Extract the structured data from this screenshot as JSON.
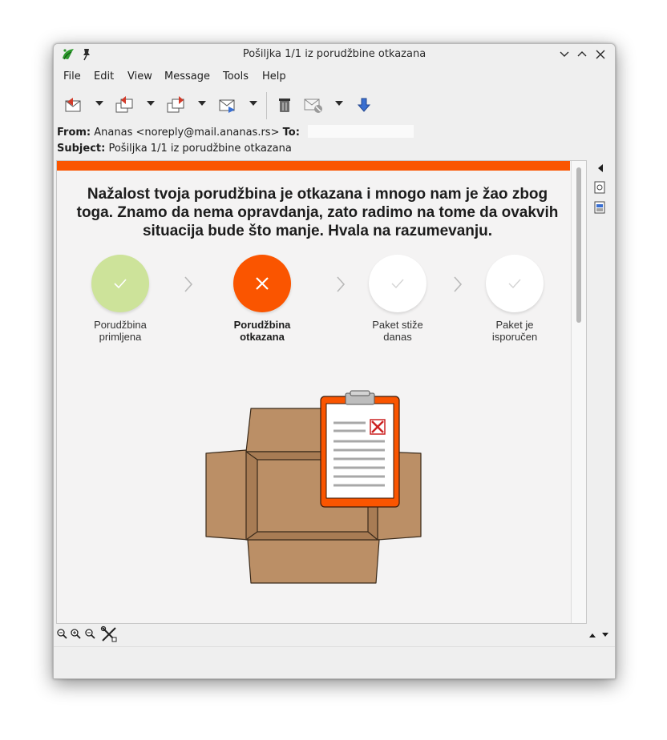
{
  "window": {
    "title": "Pošiljka 1/1 iz porudžbine otkazana"
  },
  "menu": {
    "items": [
      "File",
      "Edit",
      "View",
      "Message",
      "Tools",
      "Help"
    ]
  },
  "headers": {
    "from_label": "From:",
    "from_value": "Ananas <noreply@mail.ananas.rs>",
    "to_label": "To:",
    "subject_label": "Subject:",
    "subject_value": "Pošiljka 1/1 iz porudžbine otkazana"
  },
  "email": {
    "accent_color": "#fa5500",
    "headline": "Nažalost tvoja porudžbina je otkazana i mnogo nam je žao zbog toga. Znamo da nema opravdanja, zato radimo na tome da ovakvih situacija bude što manje. Hvala na razumevanju.",
    "steps": [
      {
        "label": "Porudžbina\nprimljena",
        "state": "done",
        "color": "#cde39a",
        "icon": "check-icon"
      },
      {
        "label": "Porudžbina\notkazana",
        "state": "cancelled",
        "color": "#fa5500",
        "icon": "cross-icon"
      },
      {
        "label": "Paket stiže\ndanas",
        "state": "pending",
        "color": "#ffffff",
        "icon": "check-icon"
      },
      {
        "label": "Paket je\nisporučen",
        "state": "pending",
        "color": "#ffffff",
        "icon": "check-icon"
      }
    ],
    "illustration": "open-box-with-cancelled-clipboard"
  },
  "toolbar": {
    "icons": [
      "reply-icon",
      "reply-all-icon",
      "forward-multiple-icon",
      "forward-icon",
      "trash-icon",
      "mark-junk-icon",
      "download-icon"
    ]
  }
}
